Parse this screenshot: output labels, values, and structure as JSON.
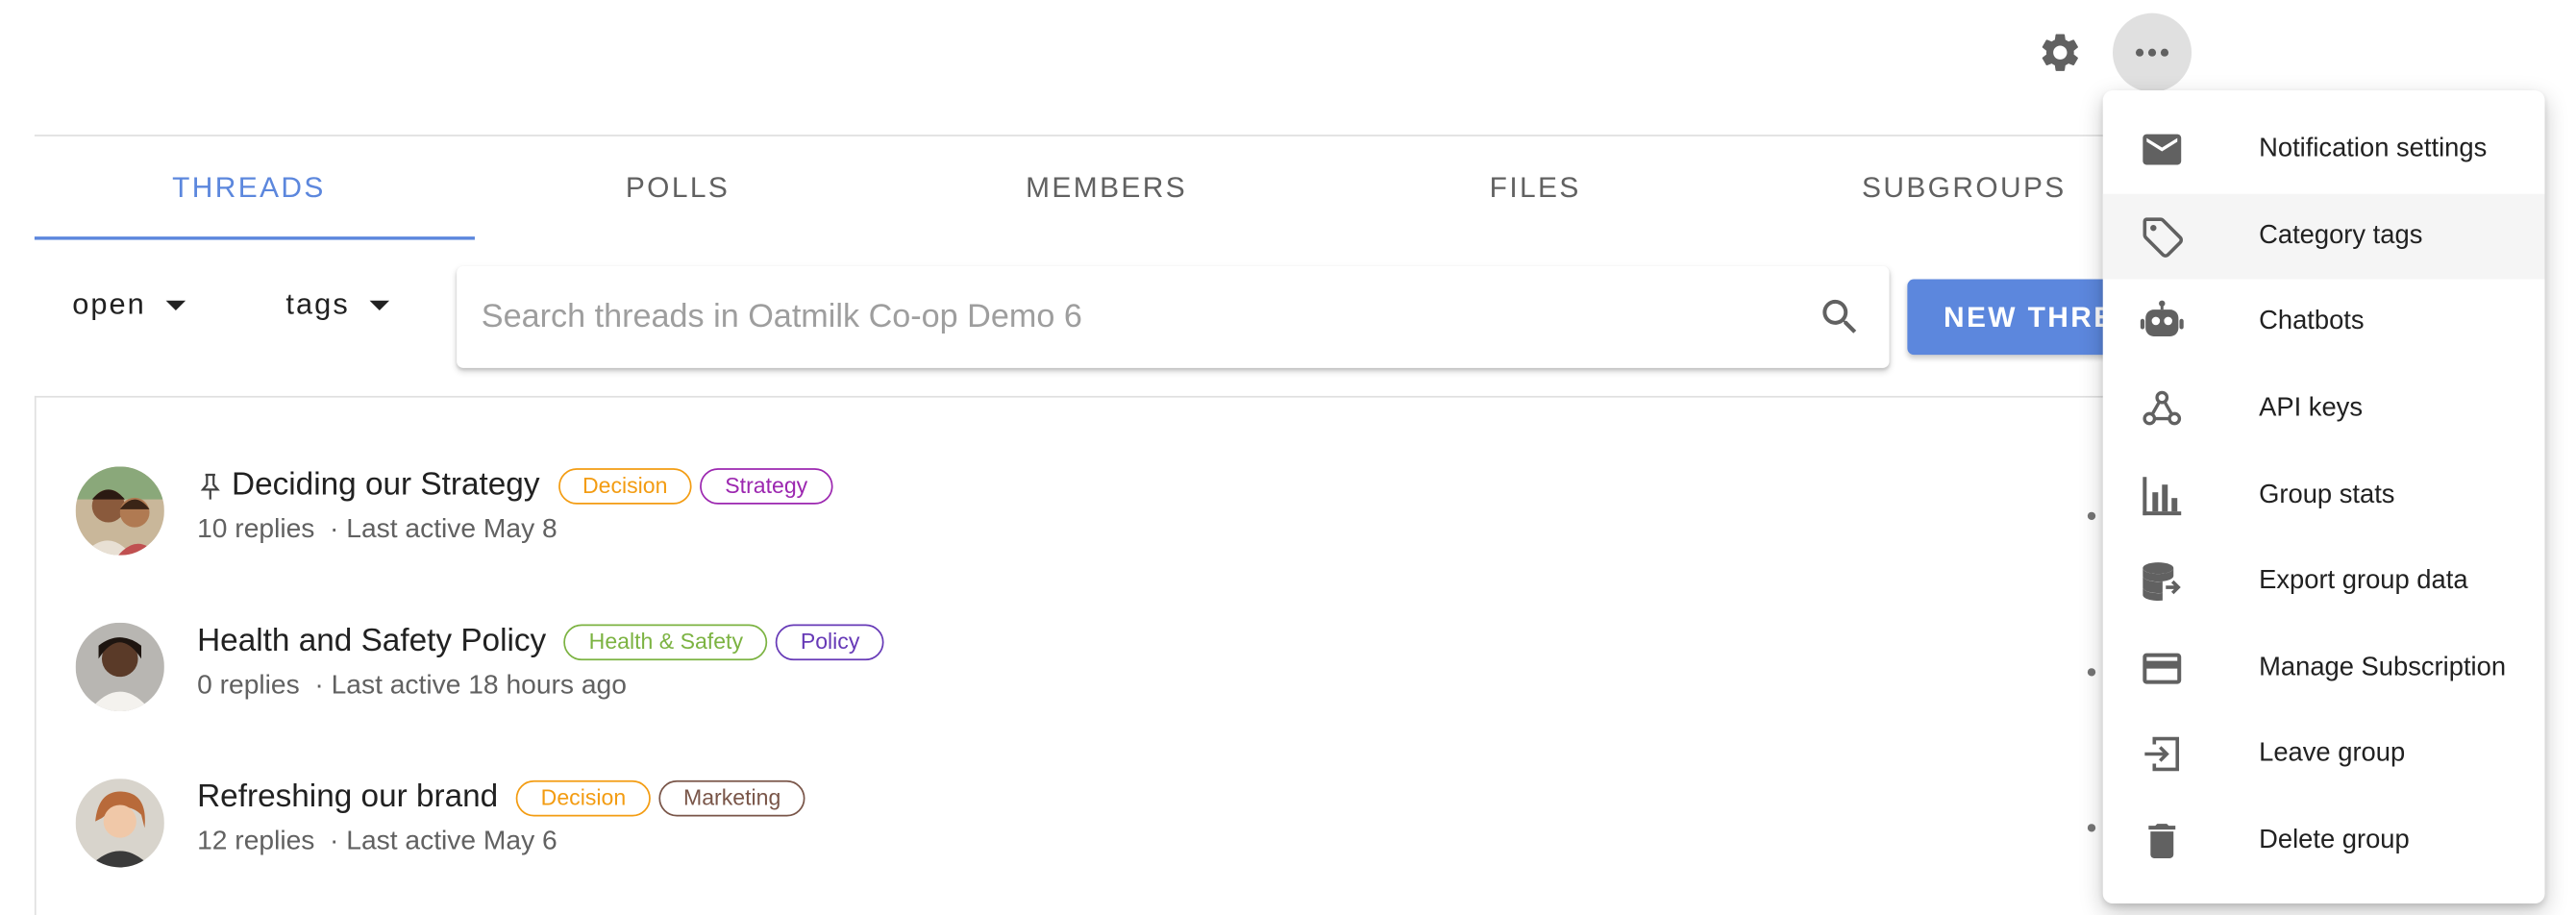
{
  "tabs": [
    {
      "label": "THREADS",
      "active": true
    },
    {
      "label": "POLLS"
    },
    {
      "label": "MEMBERS"
    },
    {
      "label": "FILES"
    },
    {
      "label": "SUBGROUPS"
    }
  ],
  "filters": {
    "status_label": "open",
    "tags_label": "tags"
  },
  "search": {
    "placeholder": "Search threads in Oatmilk Co-op Demo 6"
  },
  "new_thread_label": "NEW THREAD",
  "threads": [
    {
      "title": "Deciding our Strategy",
      "pinned": true,
      "tags": [
        {
          "label": "Decision",
          "color": "#f39c12"
        },
        {
          "label": "Strategy",
          "color": "#9c27b0"
        }
      ],
      "meta": "10 replies  · Last active May 8"
    },
    {
      "title": "Health and Safety Policy",
      "pinned": false,
      "tags": [
        {
          "label": "Health & Safety",
          "color": "#7cb342"
        },
        {
          "label": "Policy",
          "color": "#673ab7"
        }
      ],
      "meta": "0 replies  · Last active 18 hours ago"
    },
    {
      "title": "Refreshing our brand",
      "pinned": false,
      "tags": [
        {
          "label": "Decision",
          "color": "#f39c12"
        },
        {
          "label": "Marketing",
          "color": "#795548"
        }
      ],
      "meta": "12 replies  · Last active May 6"
    }
  ],
  "menu": {
    "items": [
      {
        "label": "Notification settings",
        "icon": "envelope-icon"
      },
      {
        "label": "Category tags",
        "icon": "tag-icon"
      },
      {
        "label": "Chatbots",
        "icon": "robot-icon"
      },
      {
        "label": "API keys",
        "icon": "webhook-icon"
      },
      {
        "label": "Group stats",
        "icon": "bar-chart-icon"
      },
      {
        "label": "Export group data",
        "icon": "database-export-icon"
      },
      {
        "label": "Manage Subscription",
        "icon": "credit-card-icon"
      },
      {
        "label": "Leave group",
        "icon": "exit-icon"
      },
      {
        "label": "Delete group",
        "icon": "trash-icon"
      }
    ]
  },
  "colors": {
    "accent": "#5c87dd",
    "text": "#212121",
    "muted": "#616161"
  }
}
